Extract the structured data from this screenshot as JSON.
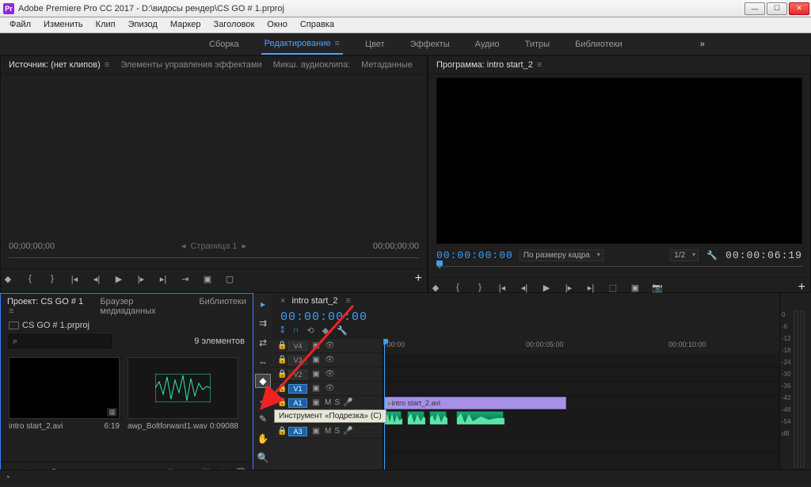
{
  "title": "Adobe Premiere Pro CC 2017 - D:\\видосы рендер\\CS GO # 1.prproj",
  "menus": [
    "Файл",
    "Изменить",
    "Клип",
    "Эпизод",
    "Маркер",
    "Заголовок",
    "Окно",
    "Справка"
  ],
  "workspaces": {
    "items": [
      "Сборка",
      "Редактирование",
      "Цвет",
      "Эффекты",
      "Аудио",
      "Титры",
      "Библиотеки"
    ],
    "active": 1,
    "overflow": "»"
  },
  "source": {
    "tabs": [
      "Источник: (нет клипов)",
      "Элементы управления эффектами",
      "Микш. аудиоклипа:",
      "Метаданные"
    ],
    "active": 0,
    "tc_in": "00;00;00;00",
    "tc_out": "00;00;00;00",
    "page_lbl": "Страница 1"
  },
  "program": {
    "tab": "Программа: intro start_2",
    "tc_in": "00:00:00:00",
    "tc_out": "00:00:06:19",
    "fit_label": "По размеру кадра",
    "scale_label": "1/2"
  },
  "project": {
    "tabs": [
      "Проект: CS GO # 1",
      "Браузер медиаданных",
      "Библиотеки"
    ],
    "active": 0,
    "file": "CS GO # 1.prproj",
    "search_placeholder": "",
    "count_label": "9 элементов",
    "items": [
      {
        "name": "intro start_2.avi",
        "dur": "6:19",
        "kind": "video"
      },
      {
        "name": "awp_Boltforward1.wav",
        "dur": "0:09088",
        "kind": "audio"
      }
    ]
  },
  "tools": [
    "pointer",
    "track-select",
    "ripple",
    "rolling",
    "razor",
    "slip",
    "pen",
    "hand",
    "zoom",
    "type"
  ],
  "timeline": {
    "tab": "intro start_2",
    "tc": "00:00:00:00",
    "ruler": [
      ":00:00",
      "00:00:05:00",
      "00:00:10:00"
    ],
    "vtracks": [
      "V4",
      "V3",
      "V2",
      "V1"
    ],
    "atracks": [
      "A1",
      "A2",
      "A3"
    ],
    "clip": "intro start_2.avi",
    "zoom_val": "0,0"
  },
  "tooltip": "Инструмент «Подрезка» (C)",
  "meters": {
    "db": [
      "0",
      "-6",
      "-12",
      "-18",
      "-24",
      "-30",
      "-36",
      "-42",
      "-48",
      "-54",
      "dB"
    ]
  }
}
